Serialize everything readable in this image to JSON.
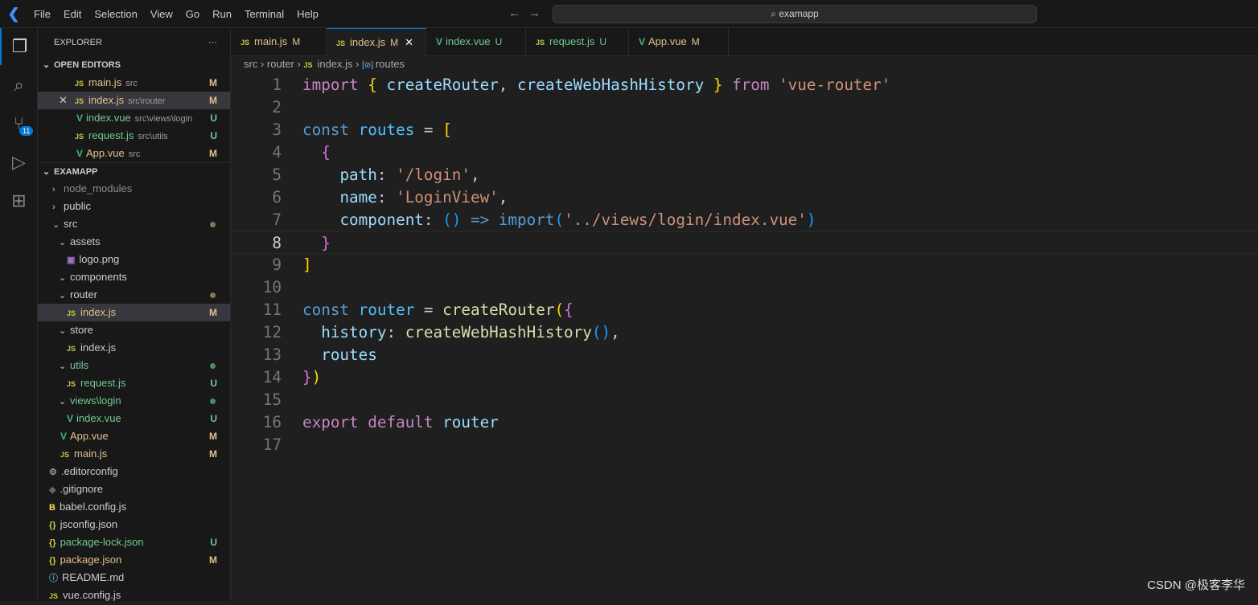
{
  "titlebar": {
    "menu": [
      "File",
      "Edit",
      "Selection",
      "View",
      "Go",
      "Run",
      "Terminal",
      "Help"
    ],
    "search": "examapp"
  },
  "activity": {
    "scm_badge": "11"
  },
  "sidebar": {
    "title": "EXPLORER",
    "more": "···",
    "open_editors_label": "OPEN EDITORS",
    "open_editors": [
      {
        "name": "main.js",
        "desc": "src",
        "status": "M",
        "icon": "js"
      },
      {
        "name": "index.js",
        "desc": "src\\router",
        "status": "M",
        "icon": "js",
        "close": "✕"
      },
      {
        "name": "index.vue",
        "desc": "src\\views\\login",
        "status": "U",
        "icon": "vue"
      },
      {
        "name": "request.js",
        "desc": "src\\utils",
        "status": "U",
        "icon": "js"
      },
      {
        "name": "App.vue",
        "desc": "src",
        "status": "M",
        "icon": "vue"
      }
    ],
    "project_label": "EXAMAPP",
    "tree": [
      {
        "name": "node_modules",
        "chev": "›",
        "indent": 0,
        "color": "#8b8b8b"
      },
      {
        "name": "public",
        "chev": "›",
        "indent": 0
      },
      {
        "name": "src",
        "chev": "⌄",
        "indent": 0,
        "dot": "M"
      },
      {
        "name": "assets",
        "chev": "⌄",
        "indent": 1
      },
      {
        "name": "logo.png",
        "icon": "img",
        "indent": 2
      },
      {
        "name": "components",
        "chev": "⌄",
        "indent": 1
      },
      {
        "name": "router",
        "chev": "⌄",
        "indent": 1,
        "dot": "M"
      },
      {
        "name": "index.js",
        "icon": "js",
        "indent": 2,
        "status": "M",
        "selected": true
      },
      {
        "name": "store",
        "chev": "⌄",
        "indent": 1
      },
      {
        "name": "index.js",
        "icon": "js",
        "indent": 2
      },
      {
        "name": "utils",
        "chev": "⌄",
        "indent": 1,
        "dot": "U"
      },
      {
        "name": "request.js",
        "icon": "js",
        "indent": 2,
        "status": "U"
      },
      {
        "name": "views\\login",
        "chev": "⌄",
        "indent": 1,
        "dot": "U"
      },
      {
        "name": "index.vue",
        "icon": "vue",
        "indent": 2,
        "status": "U"
      },
      {
        "name": "App.vue",
        "icon": "vue",
        "indent": 1,
        "status": "M"
      },
      {
        "name": "main.js",
        "icon": "js",
        "indent": 1,
        "status": "M"
      },
      {
        "name": ".editorconfig",
        "icon": "gear",
        "indent": 0
      },
      {
        "name": ".gitignore",
        "icon": "git",
        "indent": 0
      },
      {
        "name": "babel.config.js",
        "icon": "babel",
        "indent": 0
      },
      {
        "name": "jsconfig.json",
        "icon": "json",
        "indent": 0
      },
      {
        "name": "package-lock.json",
        "icon": "json",
        "indent": 0,
        "status": "U"
      },
      {
        "name": "package.json",
        "icon": "json",
        "indent": 0,
        "status": "M"
      },
      {
        "name": "README.md",
        "icon": "info",
        "indent": 0
      },
      {
        "name": "vue.config.js",
        "icon": "js",
        "indent": 0
      }
    ]
  },
  "tabs": [
    {
      "name": "main.js",
      "status": "M",
      "icon": "js"
    },
    {
      "name": "index.js",
      "status": "M",
      "icon": "js",
      "active": true,
      "close": "✕"
    },
    {
      "name": "index.vue",
      "status": "U",
      "icon": "vue"
    },
    {
      "name": "request.js",
      "status": "U",
      "icon": "js"
    },
    {
      "name": "App.vue",
      "status": "M",
      "icon": "vue"
    }
  ],
  "breadcrumb": [
    "src",
    "router",
    "index.js",
    "routes"
  ],
  "editor": {
    "current_line": 8,
    "lines": [
      [
        [
          "import",
          "kw"
        ],
        [
          " ",
          "p"
        ],
        [
          "{",
          "b1"
        ],
        [
          " ",
          "p"
        ],
        [
          "createRouter",
          "var"
        ],
        [
          ", ",
          "p"
        ],
        [
          "createWebHashHistory",
          "var"
        ],
        [
          " ",
          "p"
        ],
        [
          "}",
          "b1"
        ],
        [
          " ",
          "p"
        ],
        [
          "from",
          "kw"
        ],
        [
          " ",
          "p"
        ],
        [
          "'vue-router'",
          "str"
        ]
      ],
      [],
      [
        [
          "const",
          "kb"
        ],
        [
          " ",
          "p"
        ],
        [
          "routes",
          "cv"
        ],
        [
          " = ",
          "p"
        ],
        [
          "[",
          "b1"
        ]
      ],
      [
        [
          "  ",
          "p"
        ],
        [
          "{",
          "b2"
        ]
      ],
      [
        [
          "    ",
          "p"
        ],
        [
          "path",
          "var"
        ],
        [
          ": ",
          "p"
        ],
        [
          "'/login'",
          "str"
        ],
        [
          ",",
          "p"
        ]
      ],
      [
        [
          "    ",
          "p"
        ],
        [
          "name",
          "var"
        ],
        [
          ": ",
          "p"
        ],
        [
          "'LoginView'",
          "str"
        ],
        [
          ",",
          "p"
        ]
      ],
      [
        [
          "    ",
          "p"
        ],
        [
          "component",
          "var"
        ],
        [
          ": ",
          "p"
        ],
        [
          "()",
          "b3"
        ],
        [
          " ",
          "p"
        ],
        [
          "=>",
          "kb"
        ],
        [
          " ",
          "p"
        ],
        [
          "import",
          "kb"
        ],
        [
          "(",
          "b3"
        ],
        [
          "'../views/login/index.vue'",
          "str"
        ],
        [
          ")",
          "b3"
        ]
      ],
      [
        [
          "  ",
          "p"
        ],
        [
          "}",
          "b2"
        ]
      ],
      [
        [
          "]",
          "b1"
        ]
      ],
      [],
      [
        [
          "const",
          "kb"
        ],
        [
          " ",
          "p"
        ],
        [
          "router",
          "cv"
        ],
        [
          " = ",
          "p"
        ],
        [
          "createRouter",
          "fn"
        ],
        [
          "(",
          "b1"
        ],
        [
          "{",
          "b2"
        ]
      ],
      [
        [
          "  ",
          "p"
        ],
        [
          "history",
          "var"
        ],
        [
          ": ",
          "p"
        ],
        [
          "createWebHashHistory",
          "fn"
        ],
        [
          "()",
          "b3"
        ],
        [
          ",",
          "p"
        ]
      ],
      [
        [
          "  ",
          "p"
        ],
        [
          "routes",
          "var"
        ]
      ],
      [
        [
          "}",
          "b2"
        ],
        [
          ")",
          "b1"
        ]
      ],
      [],
      [
        [
          "export",
          "kw"
        ],
        [
          " ",
          "p"
        ],
        [
          "default",
          "kw"
        ],
        [
          " ",
          "p"
        ],
        [
          "router",
          "var"
        ]
      ],
      []
    ]
  },
  "watermark": "CSDN @极客李华"
}
